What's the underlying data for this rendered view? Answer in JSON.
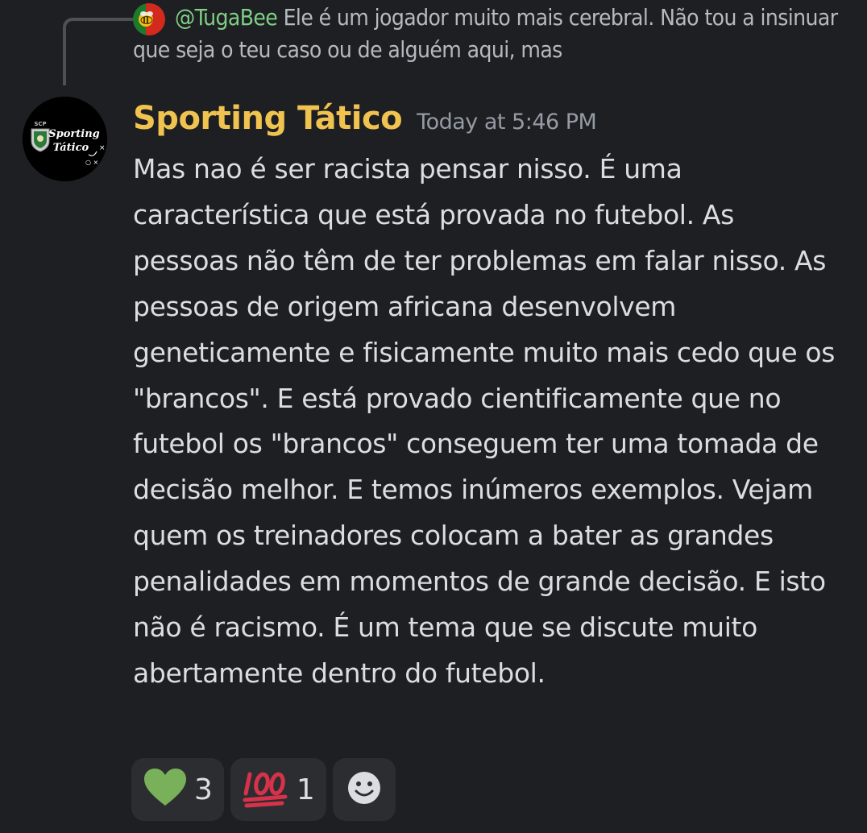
{
  "reply": {
    "mention": "@TugaBee",
    "text": " Ele é um jogador muito mais cerebral. Não tou a insinuar que seja o teu caso ou de alguém aqui, mas",
    "avatar_icon": "bee-avatar-icon"
  },
  "message": {
    "avatar_text_top": "SCP",
    "avatar_text_line1": "Sporting",
    "avatar_text_line2": "Tático",
    "username": "Sporting Tático",
    "timestamp": "Today at 5:46 PM",
    "content": "Mas nao é ser racista pensar nisso. É uma característica que está provada no futebol. As pessoas não têm de ter problemas em falar nisso. As pessoas de origem africana desenvolvem geneticamente e fisicamente muito mais cedo que os \"brancos\". E está provado cientificamente que no futebol os \"brancos\" conseguem ter uma tomada de decisão melhor. E temos inúmeros exemplos. Vejam quem os treinadores colocam a bater as grandes penalidades em momentos de grande decisão. E isto não é racismo. É um tema que se discute muito abertamente dentro do futebol."
  },
  "reactions": [
    {
      "emoji": "green-heart-icon",
      "count": "3"
    },
    {
      "emoji": "hundred-points-icon",
      "count": "1"
    }
  ],
  "add_reaction_icon": "add-reaction-smiley-icon",
  "colors": {
    "background": "#1e1f22",
    "username": "#f0c350",
    "mention": "#7fcf86",
    "reaction_bg": "#2b2d31"
  }
}
